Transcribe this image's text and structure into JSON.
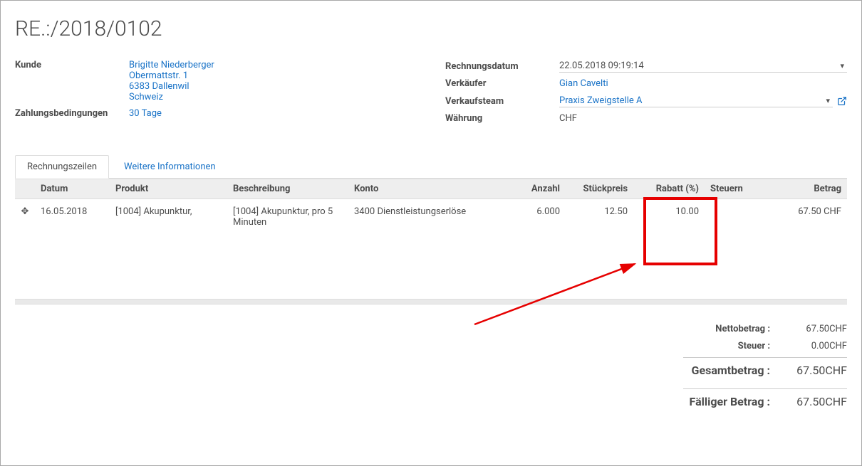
{
  "title": "RE.:/2018/0102",
  "labels": {
    "customer": "Kunde",
    "payment_terms": "Zahlungsbedingungen",
    "invoice_date": "Rechnungsdatum",
    "salesperson": "Verkäufer",
    "sales_team": "Verkaufsteam",
    "currency": "Währung"
  },
  "customer": {
    "name": "Brigitte Niederberger",
    "street": "Obermattstr. 1",
    "city": "6383 Dallenwil",
    "country": "Schweiz"
  },
  "payment_terms": "30 Tage",
  "invoice_date": "22.05.2018 09:19:14",
  "salesperson": "Gian Cavelti",
  "sales_team": "Praxis Zweigstelle A",
  "currency": "CHF",
  "tabs": {
    "lines": "Rechnungszeilen",
    "other": "Weitere Informationen"
  },
  "grid": {
    "headers": {
      "date": "Datum",
      "product": "Produkt",
      "description": "Beschreibung",
      "account": "Konto",
      "qty": "Anzahl",
      "unit_price": "Stückpreis",
      "discount": "Rabatt (%)",
      "taxes": "Steuern",
      "amount": "Betrag"
    },
    "rows": [
      {
        "date": "16.05.2018",
        "product": "[1004] Akupunktur,",
        "description": "[1004] Akupunktur, pro 5 Minuten",
        "account": "3400 Dienstleistungserlöse",
        "qty": "6.000",
        "unit_price": "12.50",
        "discount": "10.00",
        "taxes": "",
        "amount": "67.50 CHF"
      }
    ]
  },
  "totals": {
    "net_label": "Nettobetrag :",
    "net_value": "67.50CHF",
    "tax_label": "Steuer :",
    "tax_value": "0.00CHF",
    "total_label": "Gesamtbetrag :",
    "total_value": "67.50CHF",
    "due_label": "Fälliger Betrag :",
    "due_value": "67.50CHF"
  }
}
